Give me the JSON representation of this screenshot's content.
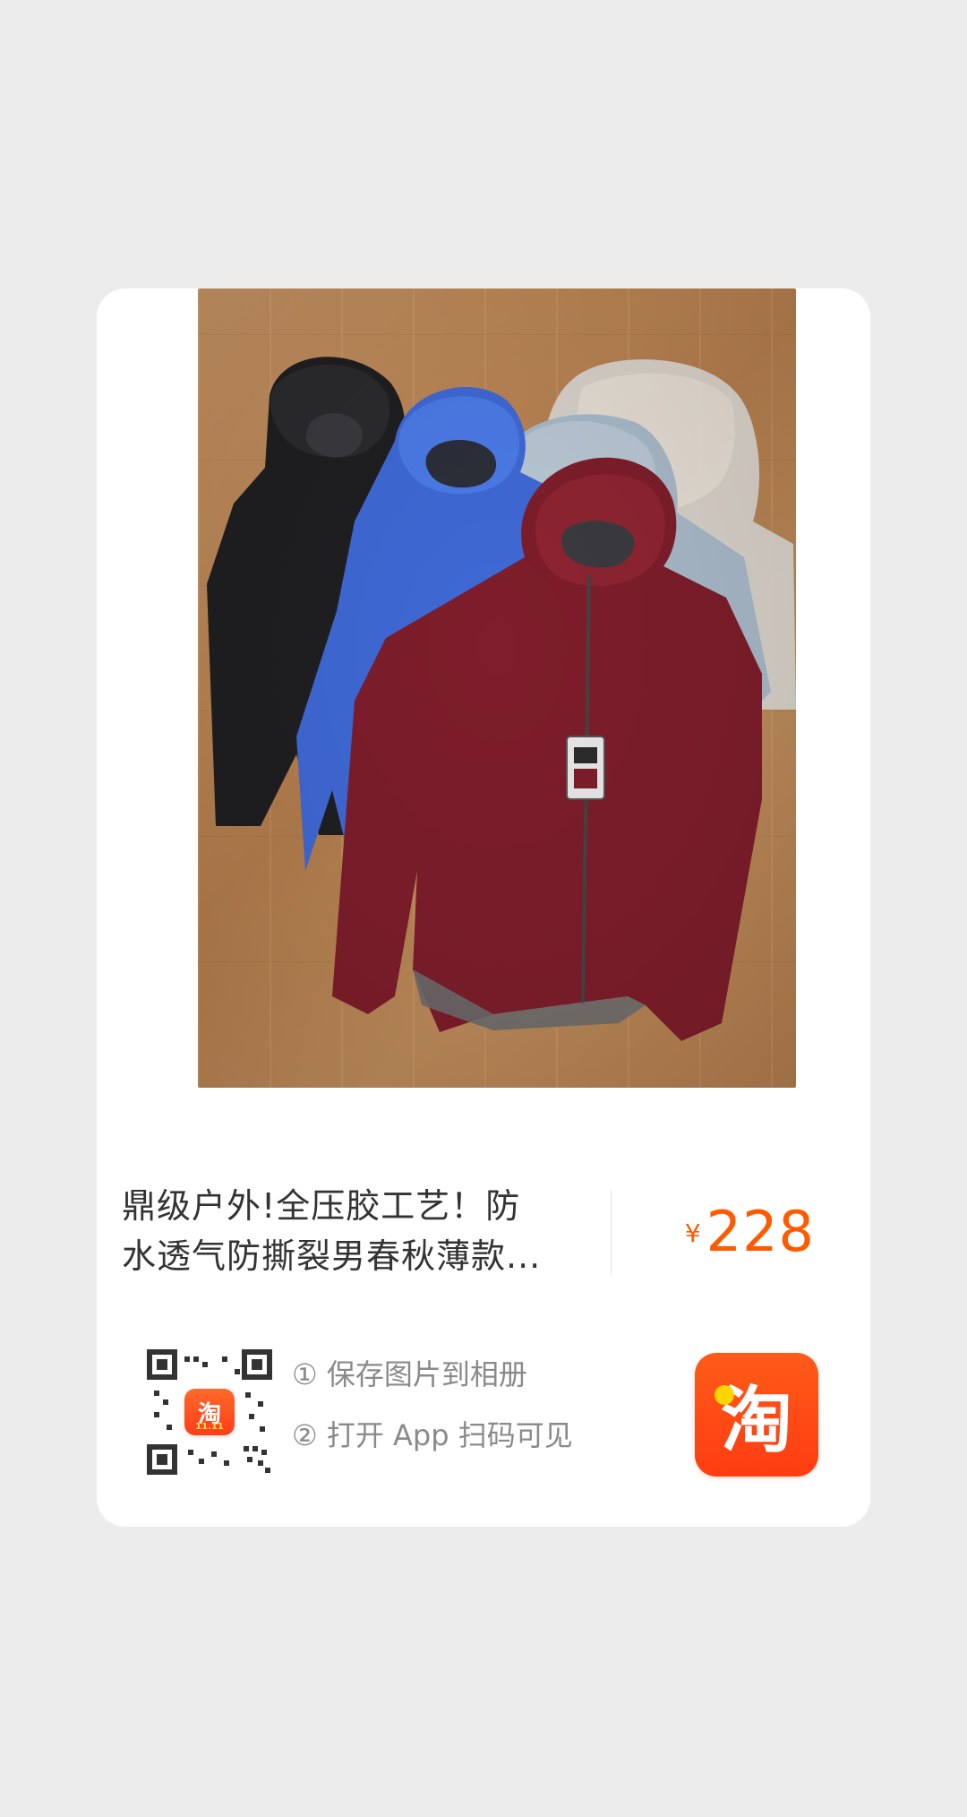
{
  "product": {
    "title_line1": "鼎级户外!全压胶工艺！防",
    "title_line2": "水透气防撕裂男春秋薄款...",
    "price_currency": "¥",
    "price_amount": "228",
    "image_icon": "product-photo-jackets"
  },
  "instructions": {
    "step1": "① 保存图片到相册",
    "step2": "② 打开 App 扫码可见"
  },
  "qr": {
    "icon": "qr-code-icon",
    "badge_label": "淘",
    "badge_sub": "11.11"
  },
  "app": {
    "icon": "taobao-app-icon",
    "label": "淘"
  },
  "colors": {
    "background": "#ececec",
    "card": "#ffffff",
    "price": "#ff5a00",
    "taobao": "#ff4d17"
  }
}
